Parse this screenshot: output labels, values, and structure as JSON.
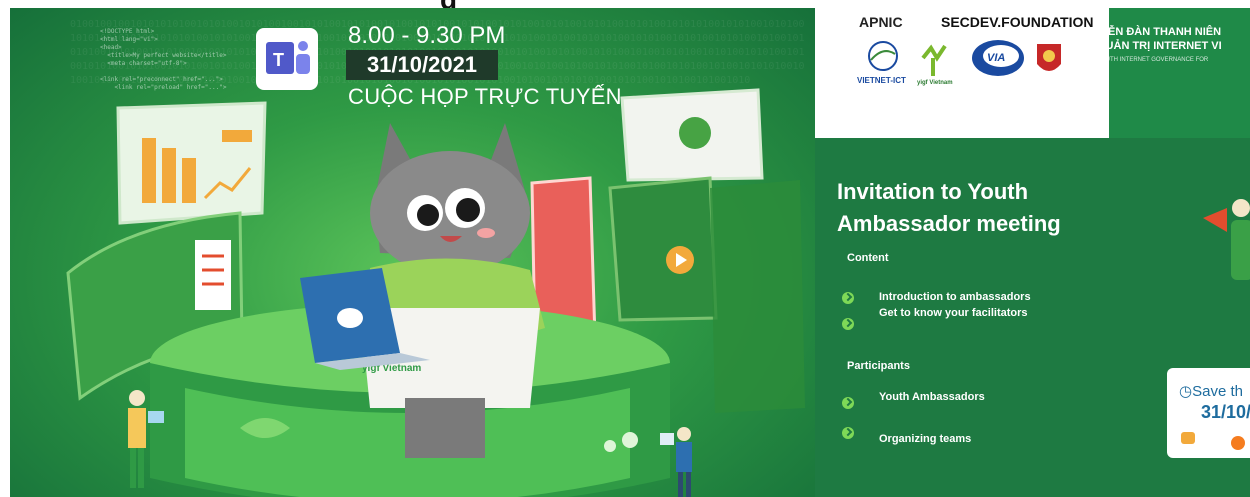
{
  "header": {
    "fragment": "g"
  },
  "event_banner": {
    "time": "8.00 - 9.30 PM",
    "date": "31/10/2021",
    "format": "CUỘC HỌP TRỰC TUYẾN",
    "app_icon": "microsoft-teams-icon",
    "hoodie_brand": "yigf Vietnam",
    "character_logo": "yigf"
  },
  "partners": {
    "apnic": "APNIC",
    "secdev_a": "SECDEV",
    "secdev_b": ".FOUNDATION",
    "vietnet": "VIETNET-ICT",
    "yigf": "yigf Vietnam",
    "via": "VIA"
  },
  "forum": {
    "line1": "DIỄN ĐÀN THANH NIÊN",
    "line2": "QUẢN TRỊ INTERNET VI",
    "subtitle": "YOUTH INTERNET GOVERNANCE FOR"
  },
  "invitation": {
    "title_line1": "Invitation to Youth",
    "title_line2": "Ambassador meeting",
    "content_heading": "Content",
    "content_items": [
      "Introduction to ambassadors",
      "Get to know your facilitators"
    ],
    "participants_heading": "Participants",
    "participant_items": [
      "Youth Ambassadors",
      "Organizing teams"
    ]
  },
  "save_card": {
    "label": "Save th",
    "date": "31/10/",
    "icon": "clock-icon"
  },
  "colors": {
    "primary_green": "#1e7a42",
    "bright_green": "#5cc45a",
    "bullet": "#7ed957",
    "save_blue": "#1e6c9e"
  }
}
